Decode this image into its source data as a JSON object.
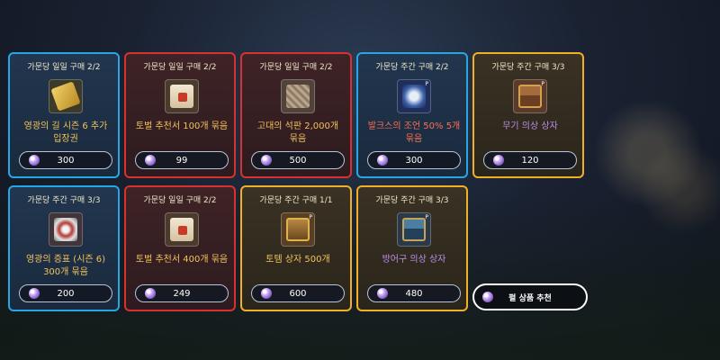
{
  "shop_items": [
    {
      "title": "가문당 일일 구매 2/2",
      "name": "영광의 길 시즌 6 추가\n입장권",
      "price": "300",
      "border_color": "#27a6e6",
      "name_color": "#f2c25c",
      "icon": "ticket-icon"
    },
    {
      "title": "가문당 일일 구매 2/2",
      "name": "토벌 추천서 100개 묶음",
      "price": "99",
      "border_color": "#d7322f",
      "name_color": "#f2c25c",
      "icon": "scroll-icon"
    },
    {
      "title": "가문당 일일 구매 2/2",
      "name": "고대의 석판 2,000개\n묶음",
      "price": "500",
      "border_color": "#d7322f",
      "name_color": "#f2c25c",
      "icon": "stone-tablet-icon"
    },
    {
      "title": "가문당 주간 구매 2/2",
      "name": "발크스의 조언 50% 5개\n묶음",
      "price": "300",
      "border_color": "#27a6e6",
      "name_color": "#ff6f52",
      "icon": "advice-book-icon"
    },
    {
      "title": "가문당 주간 구매 3/3",
      "name": "무기 의상 상자",
      "price": "120",
      "border_color": "#f0b025",
      "name_color": "#ba8ee8",
      "icon": "chest-icon"
    },
    {
      "title": "가문당 주간 구매 3/3",
      "name": "영광의 증표 (시즌 6)\n300개 묶음",
      "price": "200",
      "border_color": "#27a6e6",
      "name_color": "#f2c25c",
      "icon": "shield-badge-icon"
    },
    {
      "title": "가문당 일일 구매 2/2",
      "name": "토벌 추천서 400개 묶음",
      "price": "249",
      "border_color": "#d7322f",
      "name_color": "#f2c25c",
      "icon": "scroll-icon"
    },
    {
      "title": "가문당 주간 구매 1/1",
      "name": "토템 상자 500개",
      "price": "600",
      "border_color": "#f0b025",
      "name_color": "#f2c25c",
      "icon": "totem-box-icon"
    },
    {
      "title": "가문당 주간 구매 3/3",
      "name": "방어구 의상 상자",
      "price": "480",
      "border_color": "#f0b025",
      "name_color": "#ba8ee8",
      "icon": "chest-icon"
    }
  ],
  "recommend_button": {
    "label": "펄 상품 추천"
  },
  "currency_icon": "pearl-icon"
}
